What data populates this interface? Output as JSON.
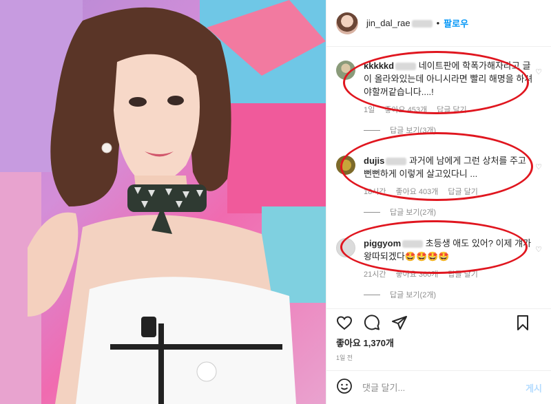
{
  "header": {
    "username": "jin_dal_rae",
    "dot": "•",
    "follow_label": "팔로우"
  },
  "comments": [
    {
      "username": "kkkkkd",
      "text": "네이트판에 학폭가해자라고 글이 올라와있는데 아니시라면 빨리 해명을 하셔야할꺼같습니다....!",
      "time": "1일",
      "likes": "좋아요 453개",
      "reply": "답글 달기",
      "view_replies": "답글 보기(3개)"
    },
    {
      "username": "dujis",
      "text": "과거에 남에게 그런 상처를 주고 뻔뻔하게 이렇게 살고있다니 ...",
      "time": "18시간",
      "likes": "좋아요 403개",
      "reply": "답글 달기",
      "view_replies": "답글 보기(2개)"
    },
    {
      "username": "piggyom",
      "text": "초등생 애도 있어? 이제 걔가 왕따되겠다🤩🤩🤩🤩",
      "time": "21시간",
      "likes": "좋아요 360개",
      "reply": "답글 달기",
      "view_replies": "답글 보기(2개)"
    }
  ],
  "actions": {
    "like_icon": "heart-icon",
    "comment_icon": "comment-icon",
    "share_icon": "share-icon",
    "save_icon": "bookmark-icon"
  },
  "likes_count": "좋아요 1,370개",
  "post_time": "1일 전",
  "add_comment": {
    "emoji_icon": "smiley-icon",
    "placeholder": "댓글 달기...",
    "post_label": "게시"
  },
  "colors": {
    "accent": "#0095f6",
    "annotation": "#e0161f",
    "muted": "#8e8e8e"
  }
}
